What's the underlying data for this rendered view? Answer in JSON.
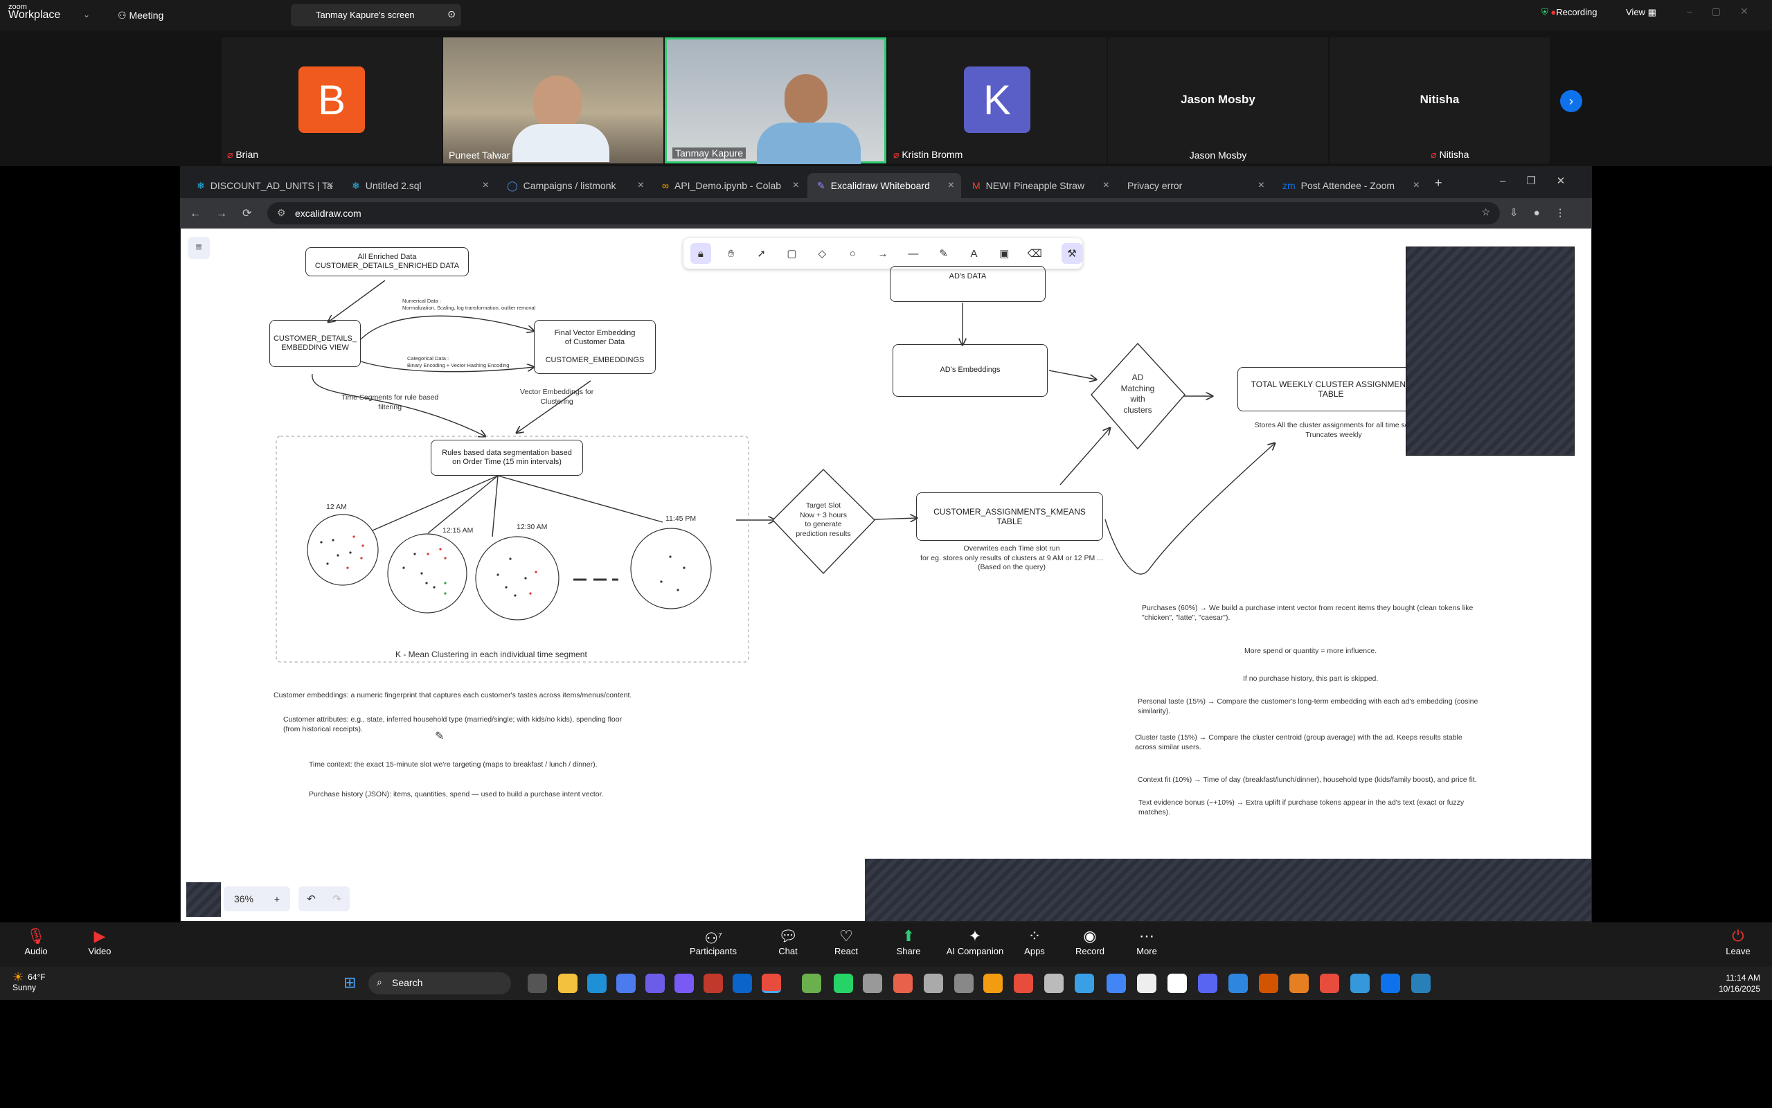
{
  "zoom": {
    "brand": "zoom",
    "app": "Workplace",
    "meeting_label": "Meeting",
    "share_tab": "Tanmay Kapure's screen",
    "recording": "Recording",
    "view": "View"
  },
  "participants": [
    {
      "name": "Brian",
      "initial": "B",
      "color": "#f05a1e"
    },
    {
      "name": "Puneet Talwar"
    },
    {
      "name": "Tanmay Kapure"
    },
    {
      "name": "Kristin Bromm",
      "initial": "K",
      "color": "#5a5fc8"
    },
    {
      "name": "Jason Mosby"
    },
    {
      "name": "Nitisha"
    }
  ],
  "browser": {
    "tabs": [
      "DISCOUNT_AD_UNITS | Ta",
      "Untitled 2.sql",
      "Campaigns / listmonk",
      "API_Demo.ipynb - Colab",
      "Excalidraw Whiteboard",
      "NEW! Pineapple Straw",
      "Privacy error",
      "Post Attendee - Zoom"
    ],
    "url": "excalidraw.com"
  },
  "diagram": {
    "enriched": "All Enriched Data\nCUSTOMER_DETAILS_ENRICHED DATA",
    "embview": "CUSTOMER_DETAILS_\nEMBEDDING VIEW",
    "numerical": "Numerical Data :\nNormalization, Scaling, log transformation, outlier removal",
    "categorical": "Categorical Data :\nBinary Encoding + Vector Hashing Encoding",
    "final": "Final Vector Embedding\nof Customer Data\n\nCUSTOMER_EMBEDDINGS",
    "time_segments": "Time Segments for rule based\nfiltering",
    "vector_emb": "Vector Embeddings for\nClustering",
    "rules": "Rules based data segmentation based\non Order Time (15 min intervals)",
    "t1": "12 AM",
    "t2": "12:15 AM",
    "t3": "12:30 AM",
    "t4": "11:45 PM",
    "kmeans": "K - Mean Clustering in each individual time segment",
    "target": "Target Slot\nNow + 3 hours\nto generate\nprediction results",
    "cak": "CUSTOMER_ASSIGNMENTS_KMEANS\nTABLE",
    "overwrites": "Overwrites each Time slot run\nfor eg. stores only results of clusters at 9 AM or 12 PM ...\n(Based on the query)",
    "ads_data": "AD's DATA",
    "ads_emb": "AD's Embeddings",
    "ad_match": "AD\nMatching\nwith\nclusters",
    "total": "TOTAL WEEKLY CLUSTER ASSIGNMENT\nTABLE",
    "stores": "Stores All the cluster assignments for all time seg\nTruncates weekly",
    "notes_left": [
      "Customer embeddings: a numeric fingerprint that captures each customer's tastes across items/menus/content.",
      "Customer attributes: e.g., state, inferred household type (married/single; with kids/no kids), spending floor\n(from historical receipts).",
      "Time context: the exact 15-minute slot we're targeting (maps to breakfast / lunch / dinner).",
      "Purchase history (JSON): items, quantities, spend — used to build a purchase intent vector."
    ],
    "notes_right": [
      "Purchases (60%) → We build a purchase intent vector from recent items they bought (clean tokens like\n\"chicken\", \"latte\", \"caesar\").",
      "More spend or quantity = more influence.",
      "If no purchase history, this part is skipped.",
      "Personal taste (15%) → Compare the customer's long-term embedding with each ad's embedding (cosine\nsimilarity).",
      "Cluster taste (15%) → Compare the cluster centroid (group average) with the ad. Keeps results stable\nacross similar users.",
      "Context fit (10%) → Time of day (breakfast/lunch/dinner), household type (kids/family boost), and price fit.",
      "Text evidence bonus (~+10%) → Extra uplift if purchase tokens appear in the ad's text (exact or fuzzy\nmatches)."
    ],
    "zoom_level": "36%"
  },
  "controls": [
    "Audio",
    "Video",
    "Participants",
    "Chat",
    "React",
    "Share",
    "AI Companion",
    "Apps",
    "Record",
    "More",
    "Leave"
  ],
  "participants_count": "7",
  "weather": {
    "temp": "64°F",
    "cond": "Sunny"
  },
  "search_label": "Search",
  "clock": {
    "time": "11:14 AM",
    "date": "10/16/2025"
  },
  "accent": "#0e72ed"
}
